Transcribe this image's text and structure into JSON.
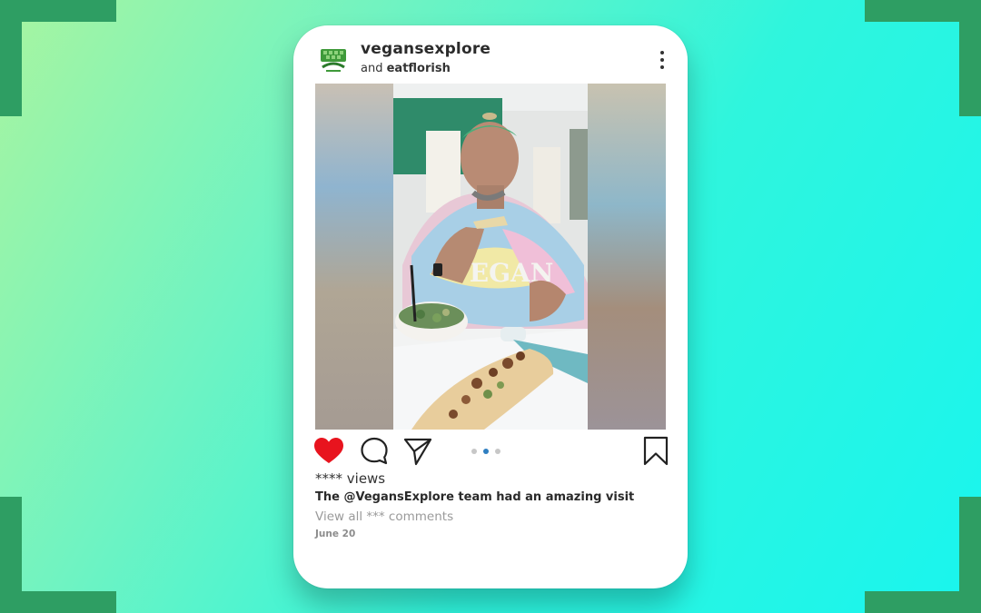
{
  "post": {
    "username": "vegansexplore",
    "collab_prefix": "and",
    "collab_user": "eatflorish",
    "avatar_logo_text": "vegans explore",
    "views": "**** views",
    "caption": "The @VegansExplore team had an amazing visit",
    "view_comments": "View all *** comments",
    "date": "June 20",
    "photo_shirt_text": "VEGAN",
    "carousel": {
      "count": 3,
      "active_index": 1
    }
  },
  "icons": {
    "like": "heart-icon",
    "comment": "comment-bubble-icon",
    "share": "paper-plane-icon",
    "save": "bookmark-icon",
    "more": "more-vertical-icon"
  },
  "colors": {
    "like_red": "#e8141e",
    "accent_green": "#2e9e63",
    "active_dot": "#2f7fc1"
  }
}
